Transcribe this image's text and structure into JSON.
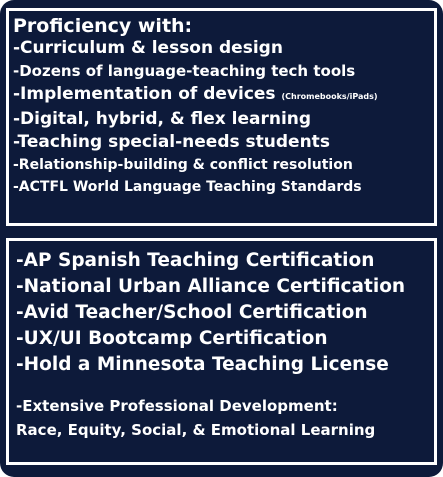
{
  "proficiency": {
    "heading": "Proficiency with:",
    "items": [
      "-Curriculum & lesson design",
      "-Dozens of language-teaching tech tools",
      "-Implementation of devices",
      "-Digital, hybrid, & flex learning",
      "-Teaching special-needs students",
      "-Relationship-building & conflict resolution",
      "-ACTFL World Language Teaching Standards"
    ],
    "devices_note": "(Chromebooks/iPads)"
  },
  "certifications": {
    "items": [
      "-AP Spanish Teaching Certification",
      "-National Urban Alliance Certification",
      "-Avid Teacher/School Certification",
      "-UX/UI Bootcamp Certification",
      "-Hold a Minnesota Teaching License"
    ],
    "development_heading": "-Extensive Professional Development:",
    "development_detail": "Race, Equity, Social, & Emotional Learning"
  }
}
